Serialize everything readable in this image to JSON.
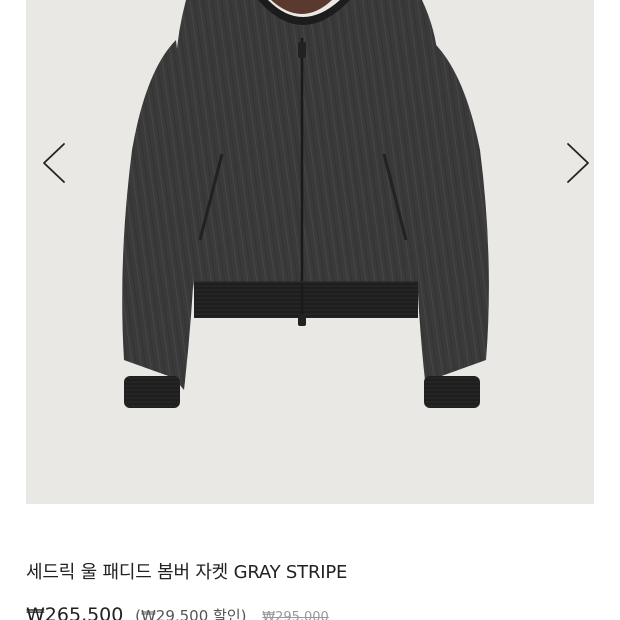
{
  "product": {
    "title": "세드릭 울 패디드 봄버 자켓 GRAY STRIPE",
    "price_current": "₩265,500",
    "price_discount": "(₩29,500 할인)",
    "price_original": "₩295,000"
  },
  "gallery": {
    "background": "#e9e8e4",
    "prev_icon": "chevron-left-icon",
    "next_icon": "chevron-right-icon"
  }
}
